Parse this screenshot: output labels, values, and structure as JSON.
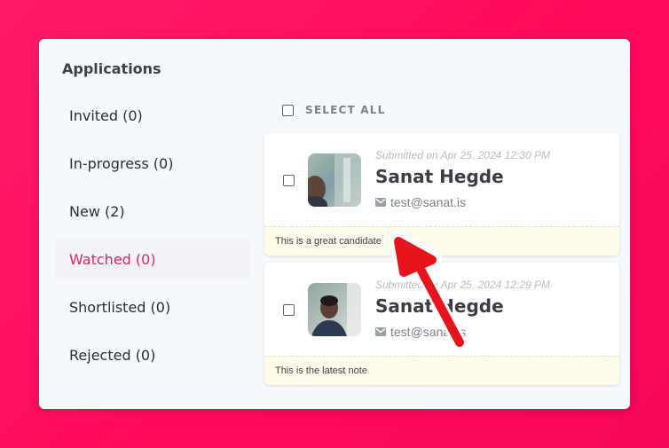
{
  "panel": {
    "title": "Applications"
  },
  "sidebar": {
    "items": [
      {
        "label": "Invited (0)"
      },
      {
        "label": "In-progress (0)"
      },
      {
        "label": "New (2)"
      },
      {
        "label": "Watched (0)",
        "active": true
      },
      {
        "label": "Shortlisted (0)"
      },
      {
        "label": "Rejected (0)"
      }
    ]
  },
  "list": {
    "select_all_label": "SELECT ALL",
    "cards": [
      {
        "submitted": "Submitted on Apr 25, 2024 12:30 PM",
        "name": "Sanat Hegde",
        "email": "test@sanat.is",
        "note": "This is a great candidate"
      },
      {
        "submitted": "Submitted on Apr 25, 2024 12:29 PM",
        "name": "Sanat Hegde",
        "email": "test@sanat.is",
        "note": "This is the latest note"
      }
    ]
  },
  "colors": {
    "accent": "#e0245e",
    "background": "#ff0a5a",
    "arrow": "#e8141c"
  },
  "icons": [
    "mail-icon",
    "checkbox-icon",
    "arrow-annotation"
  ]
}
